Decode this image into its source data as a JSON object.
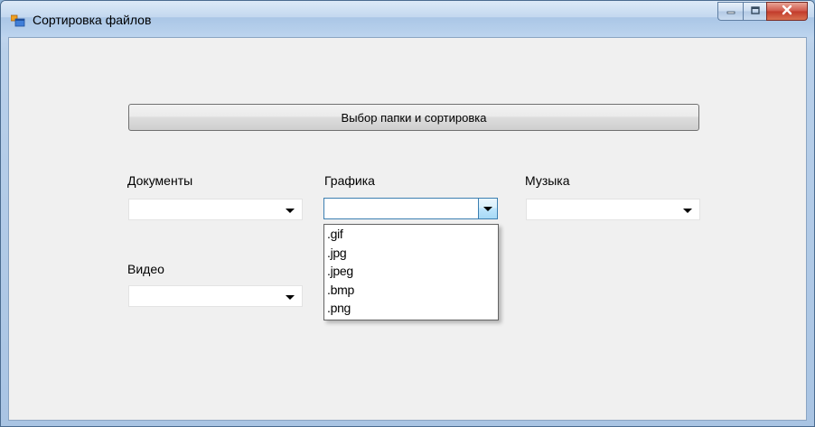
{
  "window": {
    "title": "Сортировка файлов"
  },
  "main": {
    "select_button_label": "Выбор папки и сортировка",
    "documents": {
      "label": "Документы",
      "value": ""
    },
    "graphics": {
      "label": "Графика",
      "value": ""
    },
    "music": {
      "label": "Музыка",
      "value": ""
    },
    "video": {
      "label": "Видео",
      "value": ""
    },
    "graphics_options": [
      ".gif",
      ".jpg",
      ".jpeg",
      ".bmp",
      ".png"
    ]
  },
  "icons": {
    "app": "form-icon",
    "minimize": "minimize-icon",
    "maximize": "maximize-icon",
    "close": "close-icon",
    "dropdown": "chevron-down-icon"
  },
  "colors": {
    "client_bg": "#f0f0f0",
    "focus_border": "#3c7fb1",
    "close_button": "#c23a2b"
  }
}
